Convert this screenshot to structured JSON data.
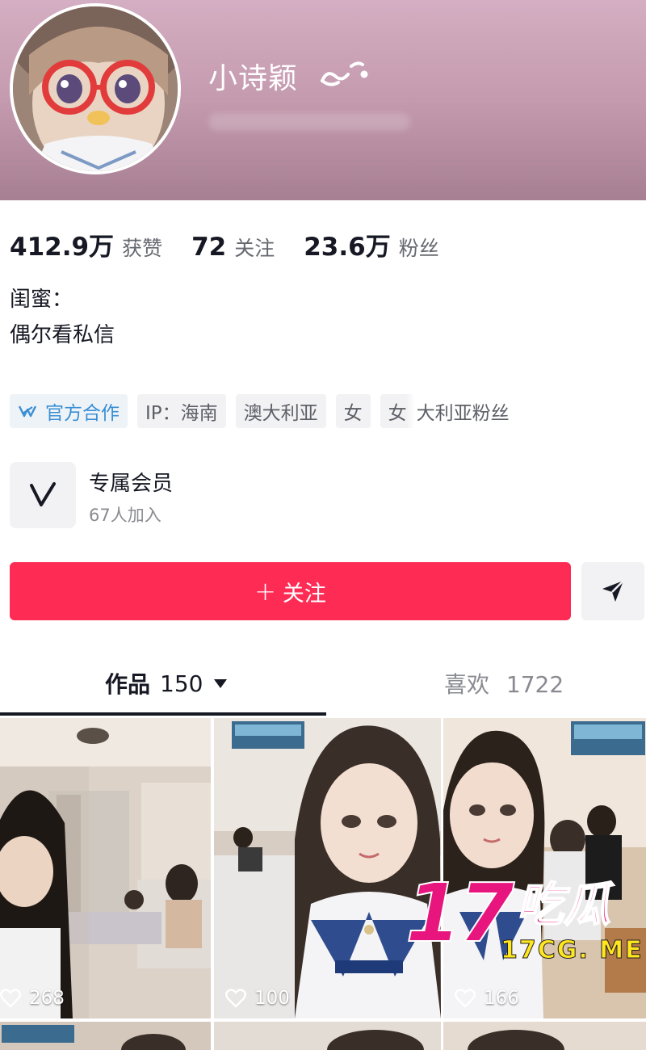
{
  "profile": {
    "nickname": "小诗颖",
    "nickname_decoration": "emoticon-face",
    "header_color": "#c49aae"
  },
  "stats": [
    {
      "value": "412.9万",
      "label": "获赞"
    },
    {
      "value": "72",
      "label": "关注"
    },
    {
      "value": "23.6万",
      "label": "粉丝"
    }
  ],
  "bio": {
    "line1": "闺蜜：",
    "line2": "偶尔看私信"
  },
  "tags": {
    "official": "官方合作",
    "ip": "IP：海南",
    "country": "澳大利亚",
    "gender": "女",
    "faded": "女",
    "overflow": "大利亚粉丝"
  },
  "membership": {
    "title": "专属会员",
    "subtitle": "67人加入",
    "icon": "v-icon"
  },
  "actions": {
    "follow_label": "关注",
    "follow_color": "#fe2c55",
    "share_icon": "send-icon"
  },
  "tabs": {
    "works": {
      "label": "作品",
      "count": "150"
    },
    "likes": {
      "label": "喜欢",
      "count": "1722"
    }
  },
  "videos": [
    {
      "likes": "268"
    },
    {
      "likes": "100"
    },
    {
      "likes": "166"
    }
  ],
  "watermark": {
    "number": "17",
    "chinese": "吃瓜",
    "url": "17CG. ME"
  }
}
